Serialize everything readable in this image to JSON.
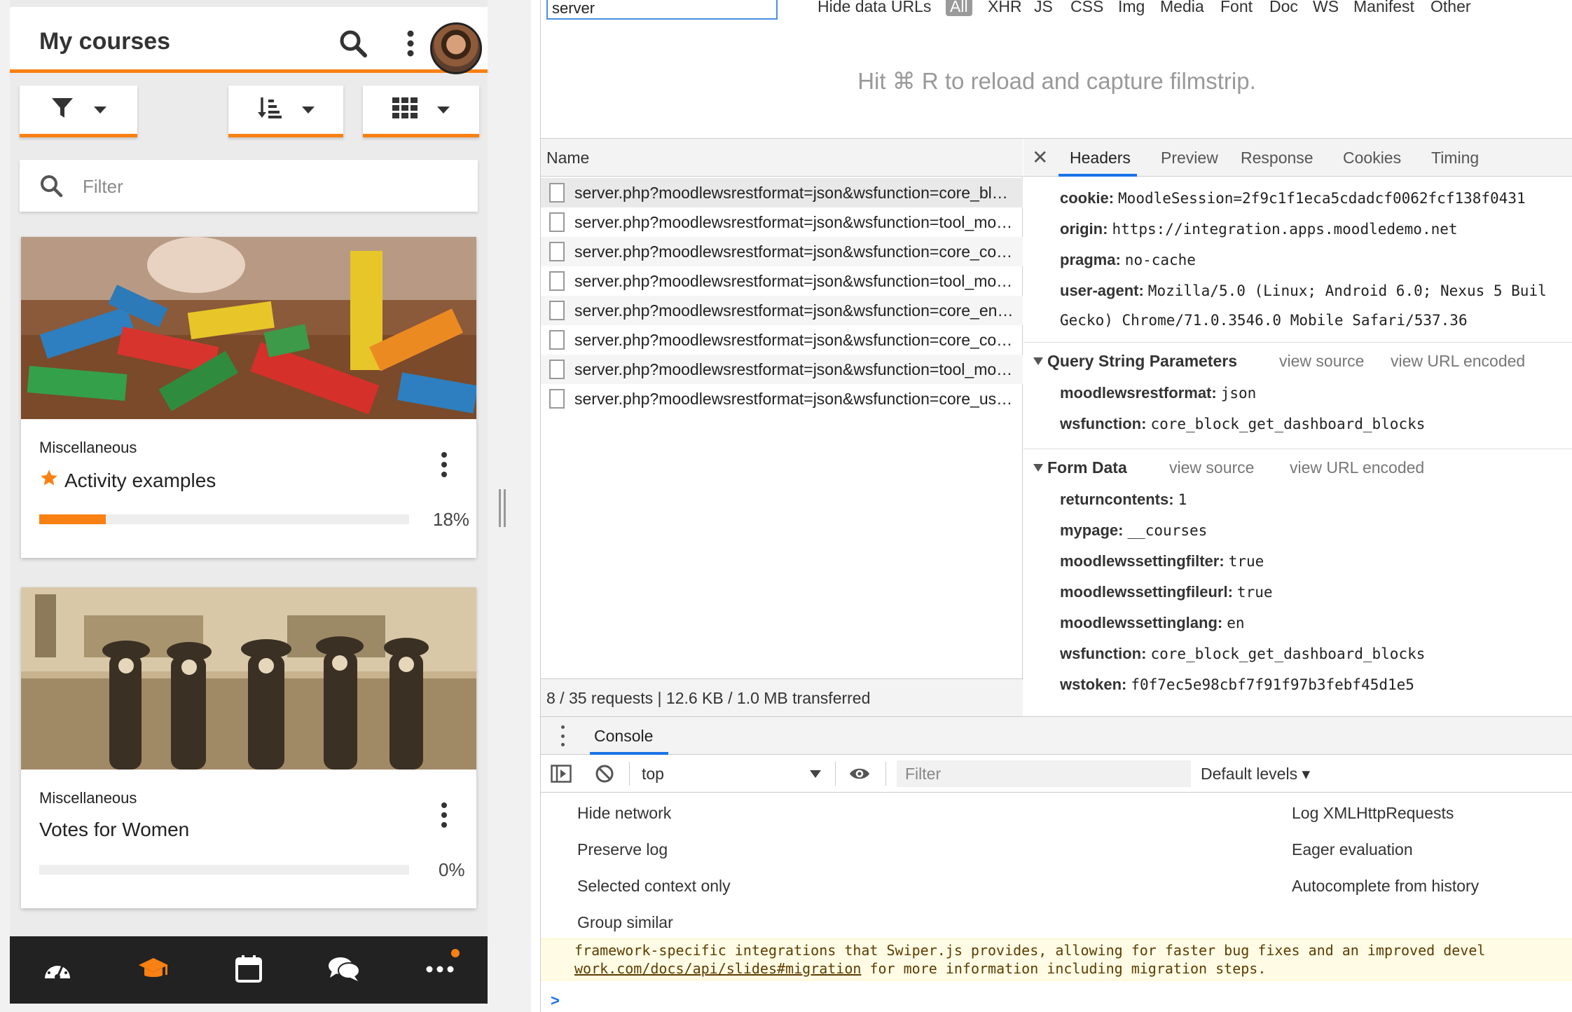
{
  "app": {
    "title": "My courses",
    "filter_placeholder": "Filter",
    "icons": {
      "search": "search-icon",
      "more": "more-vert-icon",
      "filter": "funnel-icon",
      "sort": "sort-icon",
      "view": "grid-icon"
    },
    "courses": [
      {
        "category": "Miscellaneous",
        "name": "Activity examples",
        "starred": true,
        "progress": 18,
        "progress_label": "18%"
      },
      {
        "category": "Miscellaneous",
        "name": "Votes for Women",
        "starred": false,
        "progress": 0,
        "progress_label": "0%"
      }
    ],
    "bottom_nav": [
      "dashboard-icon",
      "courses-icon",
      "calendar-icon",
      "messages-icon",
      "more-icon"
    ],
    "accent": "#f98012"
  },
  "devtools": {
    "search_value": "server",
    "hide_data_urls": "Hide data URLs",
    "type_filters": [
      "All",
      "XHR",
      "JS",
      "CSS",
      "Img",
      "Media",
      "Font",
      "Doc",
      "WS",
      "Manifest",
      "Other"
    ],
    "filmstrip_message": "Hit ⌘ R to reload and capture filmstrip.",
    "name_header": "Name",
    "requests": [
      "server.php?moodlewsrestformat=json&wsfunction=core_block_get_dashboard_blocks",
      "server.php?moodlewsrestformat=json&wsfunction=tool_mobile_get_config",
      "server.php?moodlewsrestformat=json&wsfunction=core_course_get_enrolled_courses",
      "server.php?moodlewsrestformat=json&wsfunction=tool_mobile_get_autologin_key",
      "server.php?moodlewsrestformat=json&wsfunction=core_enrol_get_users_courses",
      "server.php?moodlewsrestformat=json&wsfunction=core_course_get_courses_by_field",
      "server.php?moodlewsrestformat=json&wsfunction=tool_mobile_get_plugins_supporting_mobile",
      "server.php?moodlewsrestformat=json&wsfunction=core_user_get_user_preferences"
    ],
    "status": "8 / 35 requests | 12.6 KB / 1.0 MB transferred",
    "detail_tabs": [
      "Headers",
      "Preview",
      "Response",
      "Cookies",
      "Timing"
    ],
    "request_headers": [
      {
        "key": "cookie:",
        "value": "MoodleSession=2f9c1f1eca5cdadcf0062fcf138f0431"
      },
      {
        "key": "origin:",
        "value": "https://integration.apps.moodledemo.net"
      },
      {
        "key": "pragma:",
        "value": "no-cache"
      },
      {
        "key": "user-agent:",
        "value": "Mozilla/5.0 (Linux; Android 6.0; Nexus 5 Buil"
      },
      {
        "key": "",
        "value": "Gecko) Chrome/71.0.3546.0 Mobile Safari/537.36"
      }
    ],
    "query_section": {
      "title": "Query String Parameters",
      "view_source": "view source",
      "view_url_encoded": "view URL encoded",
      "params": [
        {
          "key": "moodlewsrestformat:",
          "value": "json"
        },
        {
          "key": "wsfunction:",
          "value": "core_block_get_dashboard_blocks"
        }
      ]
    },
    "form_section": {
      "title": "Form Data",
      "view_source": "view source",
      "view_url_encoded": "view URL encoded",
      "params": [
        {
          "key": "returncontents:",
          "value": "1"
        },
        {
          "key": "mypage:",
          "value": "__courses"
        },
        {
          "key": "moodlewssettingfilter:",
          "value": "true"
        },
        {
          "key": "moodlewssettingfileurl:",
          "value": "true"
        },
        {
          "key": "moodlewssettinglang:",
          "value": "en"
        },
        {
          "key": "wsfunction:",
          "value": "core_block_get_dashboard_blocks"
        },
        {
          "key": "wstoken:",
          "value": "f0f7ec5e98cbf7f91f97b3febf45d1e5"
        }
      ]
    },
    "console": {
      "tab": "Console",
      "context": "top",
      "filter_placeholder": "Filter",
      "levels": "Default levels ▾",
      "settings_left": [
        "Hide network",
        "Preserve log",
        "Selected context only",
        "Group similar"
      ],
      "settings_right": [
        "Log XMLHttpRequests",
        "Eager evaluation",
        "Autocomplete from history"
      ],
      "warning_line1": "framework-specific integrations that Swiper.js provides, allowing for faster bug fixes and an improved devel",
      "warning_link": "work.com/docs/api/slides#migration",
      "warning_line2_rest": " for more information including migration steps.",
      "prompt": ">"
    }
  }
}
